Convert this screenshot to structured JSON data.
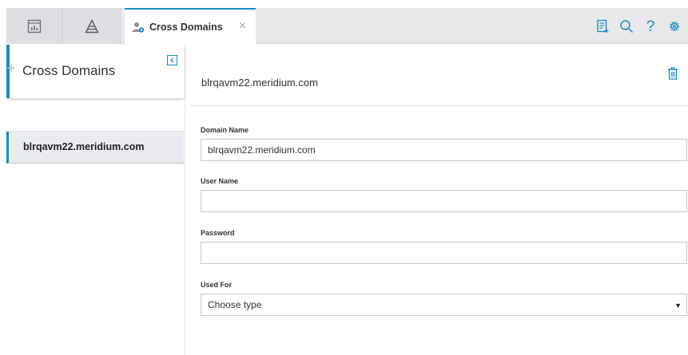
{
  "tabs": {
    "icon_tabs": [
      {
        "icon": "dashboard-icon"
      },
      {
        "icon": "pyramid-icon"
      }
    ],
    "active_tab": {
      "icon": "cross-domains-icon",
      "label": "Cross Domains",
      "close_label": "×"
    }
  },
  "top_actions": [
    {
      "icon": "new-record-icon"
    },
    {
      "icon": "search-icon"
    },
    {
      "icon": "help-icon",
      "glyph": "?"
    },
    {
      "icon": "gear-icon"
    }
  ],
  "sidebar": {
    "title": "Cross Domains",
    "add_label": "+",
    "items": [
      {
        "label": "blrqavm22.meridium.com"
      }
    ]
  },
  "record": {
    "title": "blrqavm22.meridium.com",
    "fields": {
      "domain_name": {
        "label": "Domain Name",
        "value": "blrqavm22.meridium.com"
      },
      "user_name": {
        "label": "User Name",
        "value": ""
      },
      "password": {
        "label": "Password",
        "value": ""
      },
      "used_for": {
        "label": "Used For",
        "value": "Choose type"
      }
    }
  },
  "colors": {
    "accent": "#1a8dbd",
    "tab_bg": "#e6e8ea",
    "selected_item_bg": "#e9ecef"
  }
}
